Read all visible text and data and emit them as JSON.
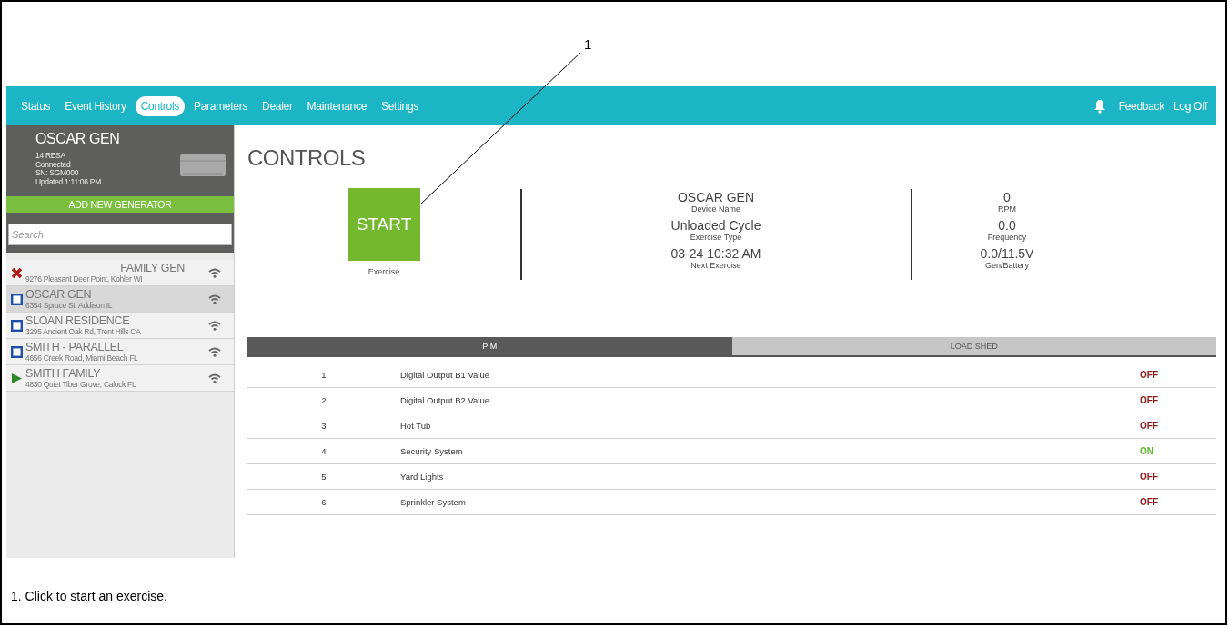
{
  "callout": {
    "number": "1"
  },
  "nav": {
    "tabs": [
      {
        "label": "Status",
        "selected": false
      },
      {
        "label": "Event History",
        "selected": false
      },
      {
        "label": "Controls",
        "selected": true
      },
      {
        "label": "Parameters",
        "selected": false
      },
      {
        "label": "Dealer",
        "selected": false
      },
      {
        "label": "Maintenance",
        "selected": false
      },
      {
        "label": "Settings",
        "selected": false
      }
    ],
    "links": [
      "Feedback",
      "Log Off"
    ]
  },
  "sidebar": {
    "generator": {
      "name": "OSCAR GEN",
      "details": [
        "14 RESA",
        "Connected",
        "SN: SGM000",
        "Updated 1:11:06 PM"
      ]
    },
    "add_button": "ADD NEW GENERATOR",
    "search": {
      "placeholder": "Search"
    },
    "items": [
      {
        "name": "FAMILY GEN",
        "address": "9276 Pleasant Deer Point, Kohler WI",
        "kind": "fault",
        "selected": false
      },
      {
        "name": "OSCAR GEN",
        "address": "6354 Spruce St, Addison IL",
        "kind": "stopped",
        "selected": true
      },
      {
        "name": "SLOAN RESIDENCE",
        "address": "3295 Ancient Oak Rd, Trent Hills CA",
        "kind": "stopped",
        "selected": false
      },
      {
        "name": "SMITH - PARALLEL",
        "address": "4656 Creek Road, Miami Beach FL",
        "kind": "stopped",
        "selected": false
      },
      {
        "name": "SMITH FAMILY",
        "address": "4830 Quiet Tiber Grove, Calock FL",
        "kind": "running",
        "selected": false
      }
    ]
  },
  "main": {
    "title": "CONTROLS",
    "start": {
      "label": "START",
      "caption": "Exercise"
    },
    "info": [
      {
        "value": "OSCAR GEN",
        "label": "Device Name"
      },
      {
        "value": "Unloaded Cycle",
        "label": "Exercise Type"
      },
      {
        "value": "03-24 10:32 AM",
        "label": "Next Exercise"
      }
    ],
    "readings": [
      {
        "value": "0",
        "label": "RPM"
      },
      {
        "value": "0.0",
        "label": "Frequency"
      },
      {
        "value": "0.0/11.5V",
        "label": "Gen/Battery"
      }
    ],
    "tabs": [
      {
        "label": "PIM",
        "selected": true
      },
      {
        "label": "LOAD SHED",
        "selected": false
      }
    ],
    "rows": [
      {
        "number": "1",
        "name": "Digital Output B1 Value",
        "status": "OFF",
        "on": false
      },
      {
        "number": "2",
        "name": "Digital Output B2 Value",
        "status": "OFF",
        "on": false
      },
      {
        "number": "3",
        "name": "Hot Tub",
        "status": "OFF",
        "on": false
      },
      {
        "number": "4",
        "name": "Security System",
        "status": "ON",
        "on": true
      },
      {
        "number": "5",
        "name": "Yard Lights",
        "status": "OFF",
        "on": false
      },
      {
        "number": "6",
        "name": "Sprinkler System",
        "status": "OFF",
        "on": false
      }
    ]
  },
  "caption": "1. Click to start an exercise."
}
